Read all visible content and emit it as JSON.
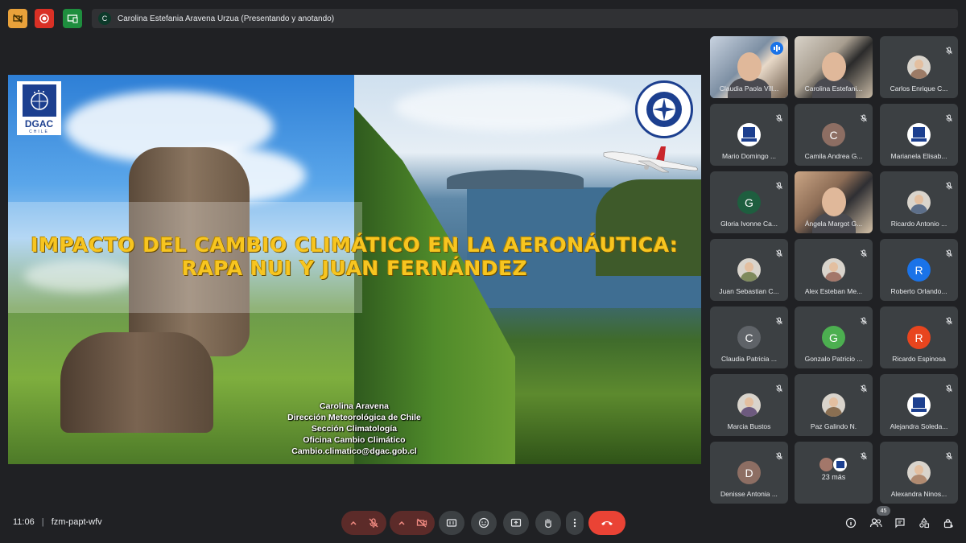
{
  "top_bar": {
    "presenter_initial": "C",
    "presenter_text": "Carolina Estefania Aravena Urzua (Presentando y anotando)"
  },
  "slide": {
    "title_line1": "IMPACTO DEL CAMBIO CLIMÁTICO EN LA AERONÁUTICA:",
    "title_line2": "RAPA NUI Y JUAN FERNÁNDEZ",
    "logo_dgac": "DGAC",
    "logo_dgac_sub": "CHILE",
    "credits": [
      "Carolina Aravena",
      "Dirección Meteorológica de Chile",
      "Sección Climatología",
      "Oficina Cambio Climático",
      "Cambio.climatico@dgac.gob.cl"
    ]
  },
  "participants": [
    {
      "name": "Claudia Paola Vill...",
      "kind": "video"
    },
    {
      "name": "Carolina Estefani...",
      "kind": "video"
    },
    {
      "name": "Carlos Enrique C...",
      "kind": "photo"
    },
    {
      "name": "Mario Domingo ...",
      "kind": "dgac"
    },
    {
      "name": "Camila Andrea G...",
      "kind": "letter",
      "initial": "C",
      "color": "#8d6e63"
    },
    {
      "name": "Marianela Elisab...",
      "kind": "dgac"
    },
    {
      "name": "Gloria Ivonne Ca...",
      "kind": "letter",
      "initial": "G",
      "color": "#1e5e3f"
    },
    {
      "name": "Ángela Margot G...",
      "kind": "video"
    },
    {
      "name": "Ricardo Antonio ...",
      "kind": "photo"
    },
    {
      "name": "Juan Sebastian C...",
      "kind": "photo"
    },
    {
      "name": "Alex Esteban Me...",
      "kind": "photo"
    },
    {
      "name": "Roberto Orlando...",
      "kind": "letter",
      "initial": "R",
      "color": "#1a73e8"
    },
    {
      "name": "Claudia Patricia ...",
      "kind": "letter",
      "initial": "C",
      "color": "#5f6368"
    },
    {
      "name": "Gonzalo Patricio ...",
      "kind": "letter",
      "initial": "G",
      "color": "#4caf50"
    },
    {
      "name": "Ricardo Espinosa",
      "kind": "letter",
      "initial": "R",
      "color": "#e8451e"
    },
    {
      "name": "Marcia Bustos",
      "kind": "photo"
    },
    {
      "name": "Paz Galindo N.",
      "kind": "photo"
    },
    {
      "name": "Alejandra Soleda...",
      "kind": "dgac"
    },
    {
      "name": "Denisse Antonia ...",
      "kind": "letter",
      "initial": "D",
      "color": "#8d6e63"
    },
    {
      "name": "23 más",
      "kind": "more"
    },
    {
      "name": "Alexandra Ninos...",
      "kind": "photo"
    }
  ],
  "bottom_bar": {
    "time": "11:06",
    "meeting_code": "fzm-papt-wfv",
    "participants_count": "45"
  },
  "colors": {
    "background": "#202124",
    "tile": "#3c4043",
    "hangup": "#ea4335",
    "title_yellow": "#f7c520"
  }
}
